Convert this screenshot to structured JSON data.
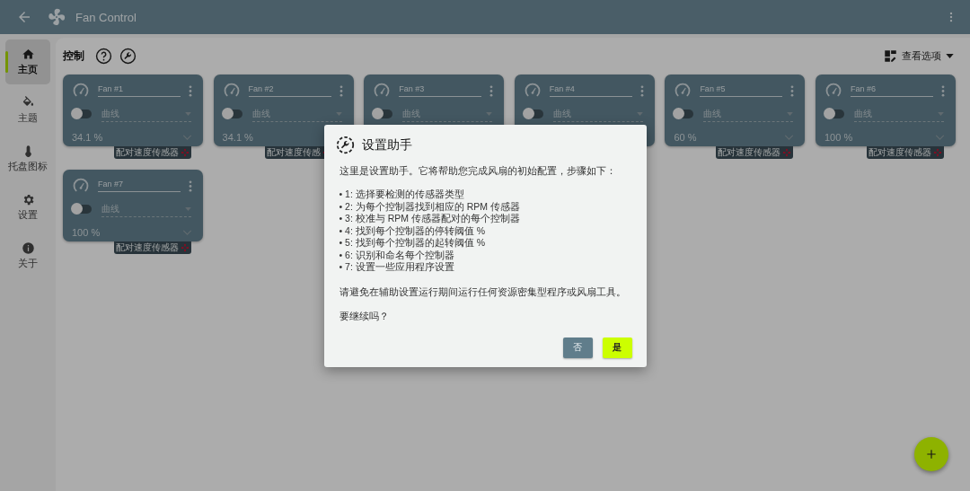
{
  "app_bar": {
    "title": "Fan Control"
  },
  "sidebar": {
    "items": [
      {
        "label": "主页",
        "selected": true
      },
      {
        "label": "主题",
        "selected": false
      },
      {
        "label": "托盘图标",
        "selected": false
      },
      {
        "label": "设置",
        "selected": false
      },
      {
        "label": "关于",
        "selected": false
      }
    ]
  },
  "header": {
    "title": "控制",
    "view_options": "查看选项"
  },
  "fans": [
    {
      "name": "Fan #1",
      "on": false,
      "curve": "曲线",
      "reading": "34.1 %",
      "badge": "配对速度传感器"
    },
    {
      "name": "Fan #2",
      "on": false,
      "curve": "曲线",
      "reading": "34.1 %",
      "badge": "配对速度传感"
    },
    {
      "name": "Fan #3",
      "on": false,
      "curve": "曲线"
    },
    {
      "name": "Fan #4",
      "on": false,
      "curve": "曲线"
    },
    {
      "name": "Fan #5",
      "on": false,
      "curve": "曲线",
      "reading": "60 %",
      "badge": "配对速度传感器"
    },
    {
      "name": "Fan #6",
      "on": false,
      "curve": "曲线",
      "reading": "100 %",
      "badge": "配对速度传感器"
    },
    {
      "name": "Fan #7",
      "on": false,
      "curve": "曲线",
      "reading": "100 %",
      "badge": "配对速度传感器"
    }
  ],
  "dialog": {
    "title": "设置助手",
    "intro": "这里是设置助手。它将帮助您完成风扇的初始配置，步骤如下：",
    "steps": [
      "• 1: 选择要检测的传感器类型",
      "• 2: 为每个控制器找到相应的 RPM 传感器",
      "• 3: 校准与 RPM 传感器配对的每个控制器",
      "• 4: 找到每个控制器的停转阈值 %",
      "• 5: 找到每个控制器的起转阈值 %",
      "• 6: 识别和命名每个控制器",
      "• 7: 设置一些应用程序设置"
    ],
    "warning": "请避免在辅助设置运行期间运行任何资源密集型程序或风扇工具。",
    "question": "要继续吗？",
    "buttons": [
      {
        "label": "否",
        "kind": "secondary"
      },
      {
        "label": "是",
        "kind": "primary"
      }
    ]
  }
}
